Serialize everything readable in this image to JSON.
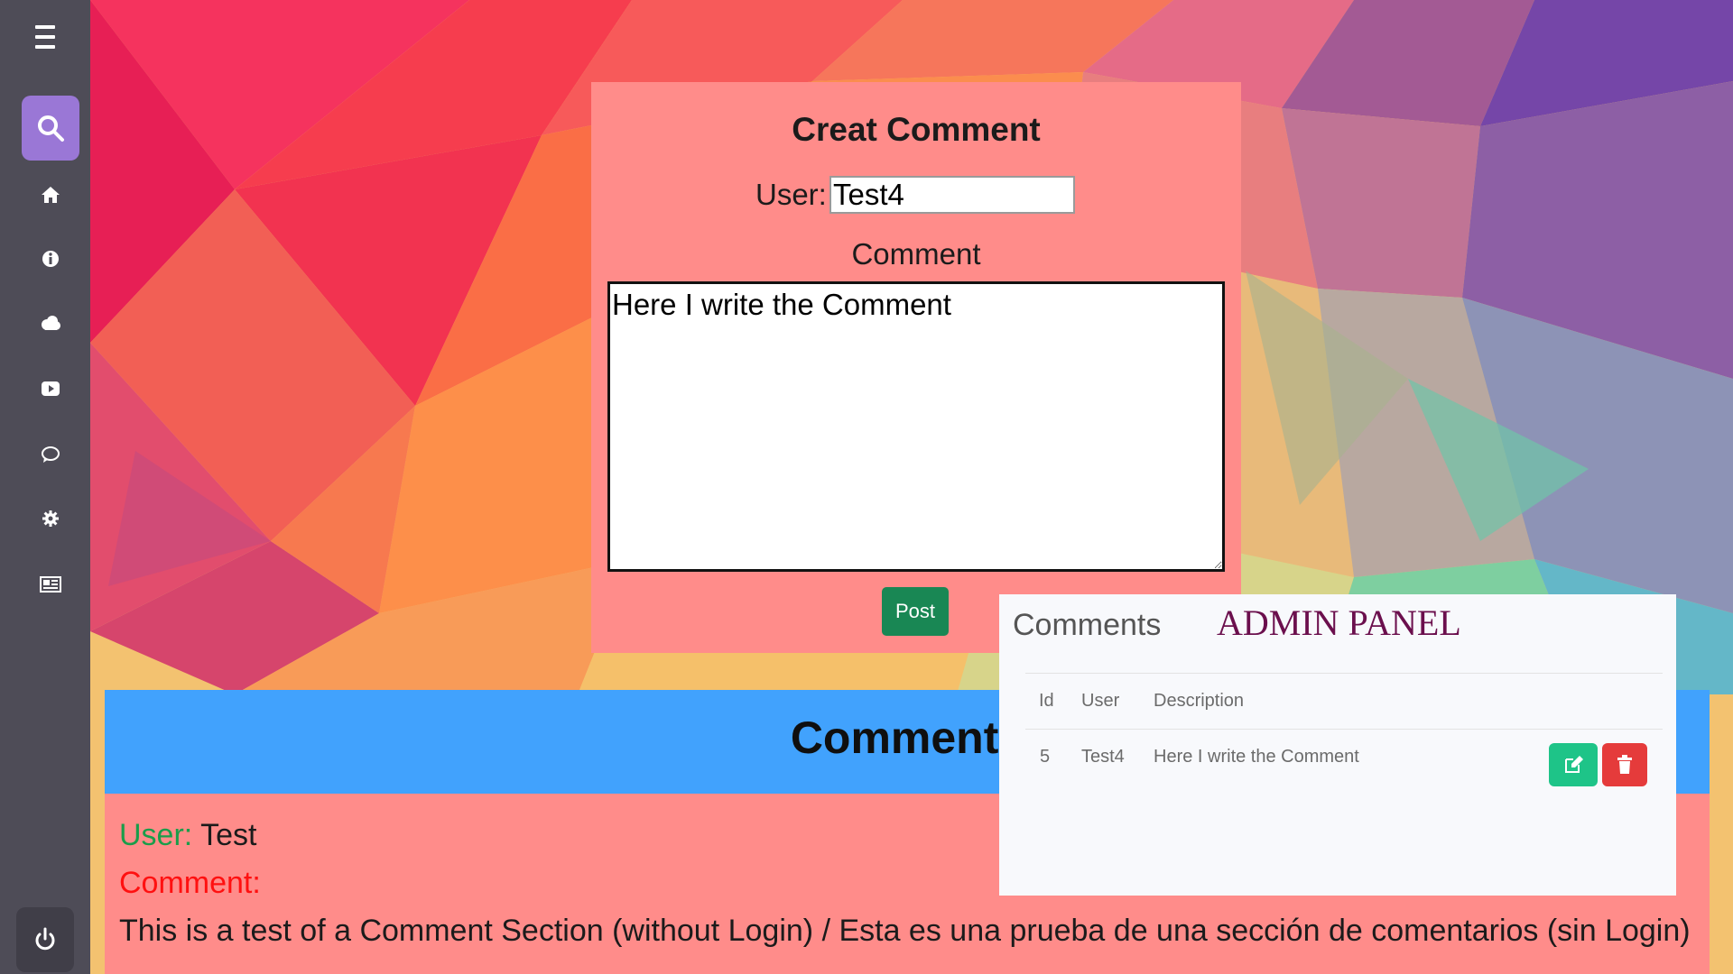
{
  "create_form": {
    "title": "Creat Comment",
    "user_label": "User:",
    "user_value": "Test4",
    "comment_label": "Comment",
    "comment_value": "Here I write the Comment",
    "post_label": "Post"
  },
  "comments_section": {
    "title": "Comments",
    "entry": {
      "user_label": "User:",
      "user_value": "Test",
      "comment_label": "Comment:",
      "comment_text": "This is a test of a Comment Section (without Login) / Esta es una prueba de una sección de comentarios (sin Login)"
    }
  },
  "admin_panel": {
    "heading": "Comments",
    "title": "ADMIN PANEL",
    "columns": [
      "Id",
      "User",
      "Description"
    ],
    "rows": [
      {
        "id": "5",
        "user": "Test4",
        "description": "Here I write the Comment"
      }
    ]
  },
  "sidebar": {
    "icons": [
      "menu-icon",
      "search-icon",
      "home-icon",
      "info-icon",
      "cloud-icon",
      "youtube-icon",
      "chat-icon",
      "gear-icon",
      "news-icon",
      "power-icon"
    ]
  },
  "colors": {
    "sidebar": "#4e4c57",
    "search_tile": "#9a77d6",
    "panel": "#ff8c8a",
    "comments_header": "#41a2fd",
    "post_button": "#198754",
    "edit_button": "#1ec488",
    "delete_button": "#e53b3b",
    "admin_title": "#6b0f4d"
  }
}
